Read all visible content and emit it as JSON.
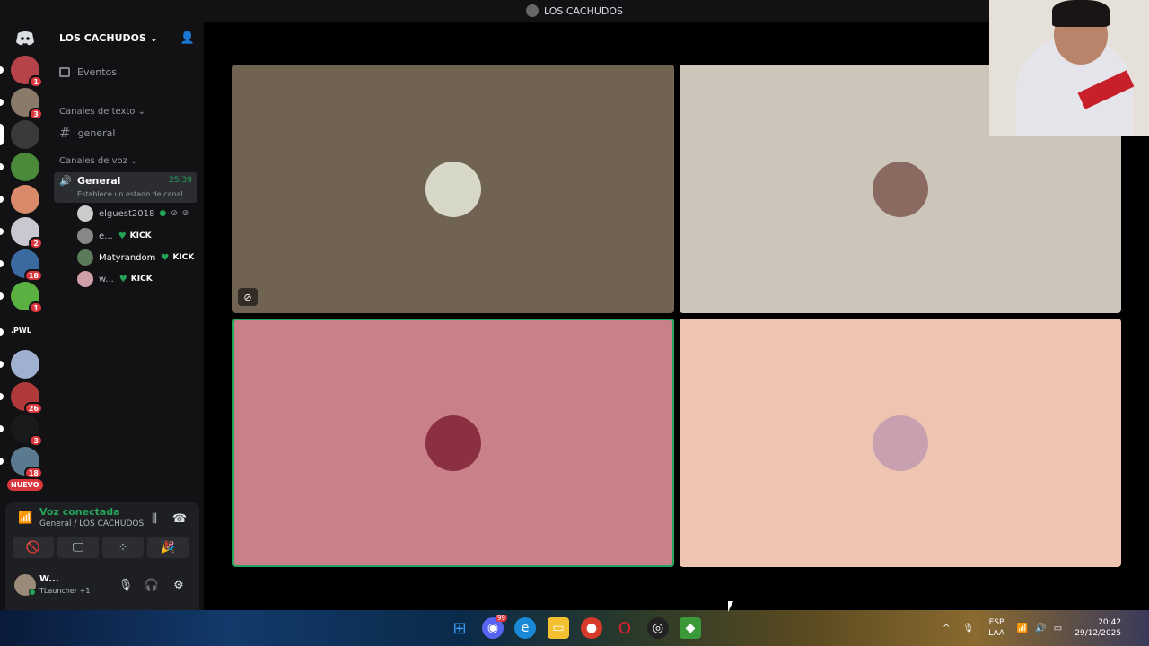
{
  "window": {
    "title": "LOS CACHUDOS"
  },
  "servers": {
    "items": [
      {
        "badge": "1",
        "color": "#b7434a"
      },
      {
        "badge": "3",
        "color": "#8a7a6a"
      },
      {
        "badge": "",
        "color": "#3a3a3a",
        "active": true
      },
      {
        "badge": "",
        "color": "#4a8a3a"
      },
      {
        "badge": "",
        "color": "#d88a6a"
      },
      {
        "badge": "2",
        "color": "#c8c8d0"
      },
      {
        "badge": "18",
        "color": "#3a6aa0"
      },
      {
        "badge": "1",
        "color": "#5ab040"
      },
      {
        "badge": "",
        "color": "#222",
        "label": ".PWL"
      },
      {
        "badge": "",
        "color": "#a0b0d0"
      },
      {
        "badge": "26",
        "color": "#b03a3a"
      },
      {
        "badge": "3",
        "color": "#1a1a1a"
      },
      {
        "badge": "18",
        "color": "#5a7a90"
      }
    ],
    "nuevo": "NUEVO"
  },
  "sidebar": {
    "guild_name": "LOS CACHUDOS",
    "events_label": "Eventos",
    "text_category": "Canales de texto",
    "text_channel": "general",
    "voice_category": "Canales de voz",
    "voice_channel": {
      "name": "General",
      "timer": "25:39",
      "status": "Establece un estado de canal"
    },
    "voice_users": [
      {
        "name": "elguest2018",
        "kick": false,
        "color": "#ccc"
      },
      {
        "name": "e...",
        "kick": true,
        "kick_label": "KICK",
        "color": "#888"
      },
      {
        "name": "Matyrandom",
        "kick": true,
        "kick_label": "KICK",
        "color": "#5a7a5a"
      },
      {
        "name": "w...",
        "kick": true,
        "kick_label": "KICK",
        "color": "#d0a0a8"
      }
    ]
  },
  "voice_panel": {
    "status": "Voz conectada",
    "location": "General / LOS CACHUDOS",
    "user_name": "W...",
    "user_activity": "TLauncher +1"
  },
  "tiles": [
    {
      "bg": "#706352",
      "avatar": "#d8d8c8",
      "speaking": false,
      "muted_video": true
    },
    {
      "bg": "#cbc6b9",
      "avatar": "#8a6a60",
      "speaking": false,
      "muted_video": false
    },
    {
      "bg": "#c98088",
      "avatar": "#8a3040",
      "speaking": true,
      "muted_video": false
    },
    {
      "bg": "#efc5b2",
      "avatar": "#c8a0b0",
      "speaking": false,
      "muted_video": false
    }
  ],
  "taskbar": {
    "lang_top": "ESP",
    "lang_bottom": "LAA",
    "time": "20:42",
    "date": "29/12/2025",
    "discord_badge": "99"
  },
  "colors": {
    "accent_green": "#23a55a",
    "badge_red": "#da373c",
    "speaking_border": "#23a55a"
  }
}
